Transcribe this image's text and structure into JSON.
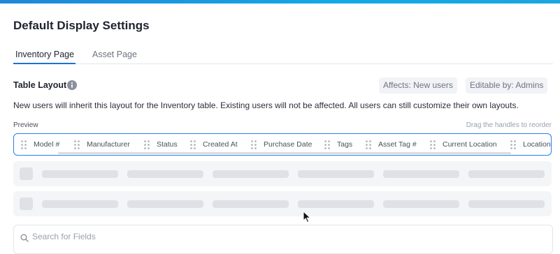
{
  "page": {
    "title": "Default Display Settings"
  },
  "tabs": [
    {
      "label": "Inventory Page",
      "active": true
    },
    {
      "label": "Asset Page",
      "active": false
    }
  ],
  "table_layout": {
    "title": "Table Layout",
    "info_icon": "info-icon",
    "badges": {
      "affects": "Affects: New users",
      "editable": "Editable by: Admins"
    },
    "description": "New users will inherit this layout for the Inventory table. Existing users will not be affected. All users can still customize their own layouts.",
    "preview_label": "Preview",
    "drag_hint": "Drag the handles to reorder"
  },
  "columns": [
    {
      "label": "Model #"
    },
    {
      "label": "Manufacturer"
    },
    {
      "label": "Status"
    },
    {
      "label": "Created At"
    },
    {
      "label": "Purchase Date"
    },
    {
      "label": "Tags"
    },
    {
      "label": "Asset Tag #"
    },
    {
      "label": "Current Location"
    },
    {
      "label": "Location"
    }
  ],
  "search": {
    "placeholder": "Search for Fields",
    "value": ""
  },
  "colors": {
    "accent": "#1b73d8",
    "top_bar": "#12a9e6",
    "skeleton": "#dfe1e6"
  }
}
